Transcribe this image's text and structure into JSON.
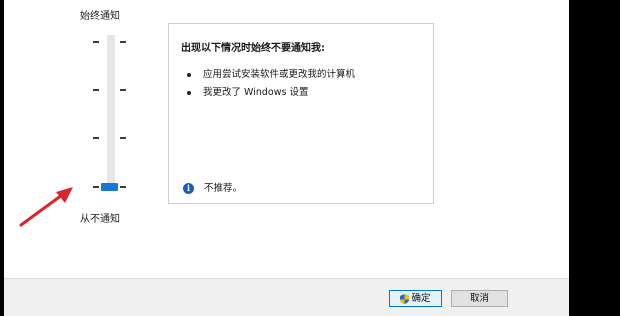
{
  "slider": {
    "top_label": "始终通知",
    "bottom_label": "从不通知",
    "level_index": 0,
    "levels_count": 4
  },
  "info": {
    "title": "出现以下情况时始终不要通知我:",
    "bullets": [
      "应用尝试安装软件或更改我的计算机",
      "我更改了 Windows 设置"
    ],
    "note": "不推荐。"
  },
  "buttons": {
    "ok": "确定",
    "cancel": "取消"
  },
  "icons": {
    "info": "info-icon",
    "shield": "uac-shield-icon",
    "arrow": "red-arrow-icon"
  },
  "colors": {
    "accent": "#1677d8",
    "annotation_arrow": "#d9262b"
  }
}
